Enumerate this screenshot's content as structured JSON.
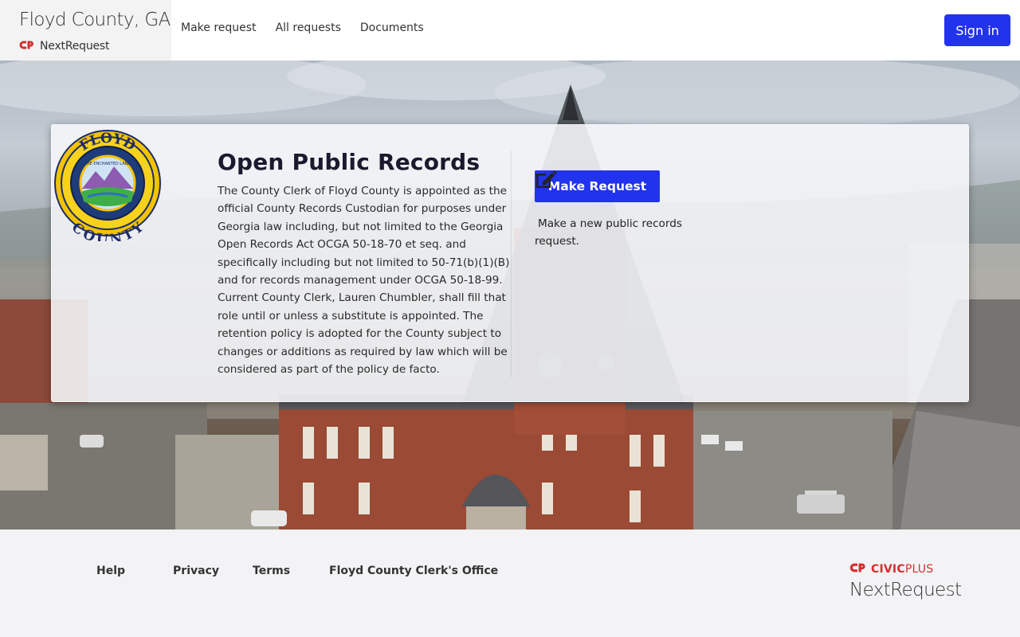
{
  "header": {
    "org_name": "Floyd County, GA",
    "brand_label": "NextRequest",
    "nav": {
      "make_request": "Make request",
      "all_requests": "All requests",
      "documents": "Documents"
    },
    "sign_in": "Sign in"
  },
  "card": {
    "seal_text": {
      "top": "FLOYD",
      "bottom": "COUNTY",
      "inner": "THE ENCHANTED LAND"
    },
    "title": "Open Public Records",
    "body": "The County Clerk of Floyd County is appointed as the official County Records Custodian for purposes under Georgia law including, but not limited to the Georgia Open Records Act OCGA 50-18-70 et seq. and specifically including but not limited to 50-71(b)(1)(B) and for records management under OCGA 50-18-99. Current County Clerk, Lauren Chumbler, shall fill that role until or unless a substitute is appointed. The retention policy is adopted for the County subject to changes or additions as required by law which will be considered as part of the policy de facto.",
    "make_request_button": "Make Request",
    "make_request_desc": "Make a new public records request."
  },
  "footer": {
    "links": {
      "help": "Help",
      "privacy": "Privacy",
      "terms": "Terms",
      "clerk_office": "Floyd County Clerk's Office"
    },
    "civic_brand": "CIVIC",
    "civic_brand_suffix": "PLUS",
    "product": "NextRequest"
  },
  "colors": {
    "primary_button": "#2233ee",
    "civic_red": "#d32f2f"
  },
  "icons": [
    "civicplus-logo-icon",
    "edit-icon"
  ]
}
